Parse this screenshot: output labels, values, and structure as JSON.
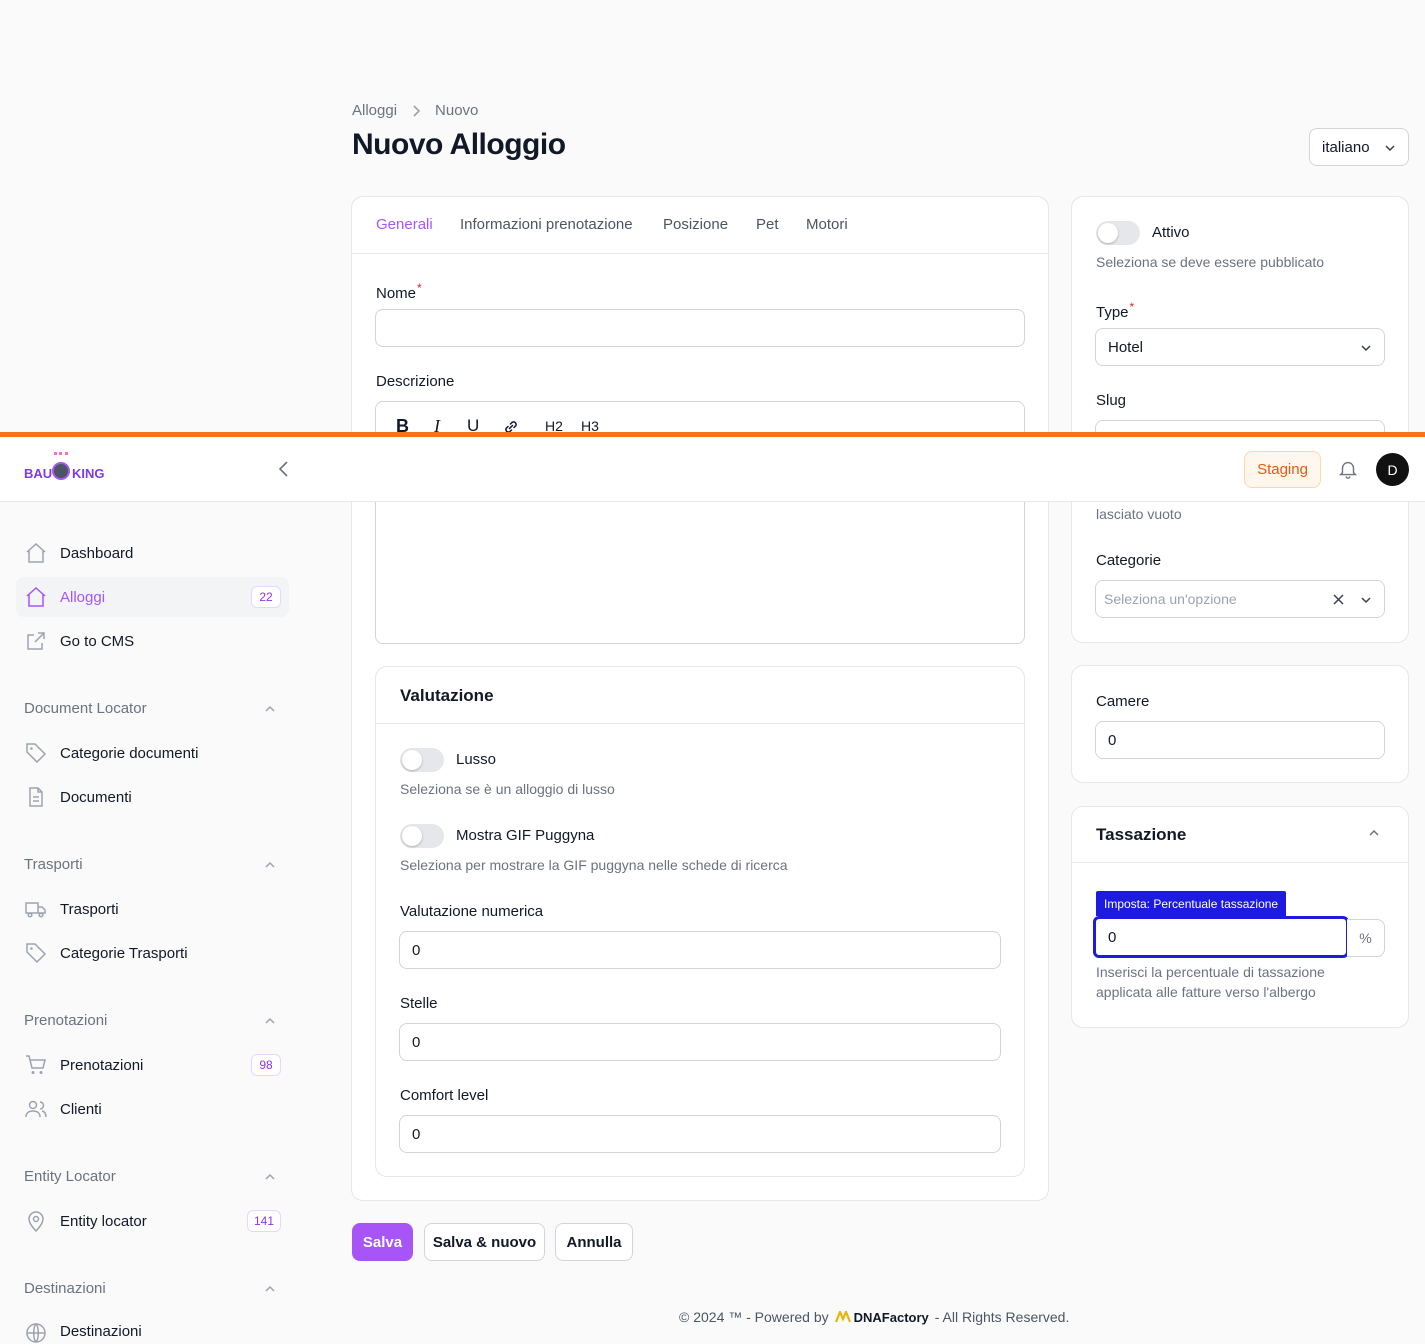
{
  "breadcrumb": {
    "parent": "Alloggi",
    "current": "Nuovo"
  },
  "page_title": "Nuovo Alloggio",
  "language_select": {
    "value": "italiano"
  },
  "tabs": [
    {
      "label": "Generali",
      "active": true
    },
    {
      "label": "Informazioni prenotazione"
    },
    {
      "label": "Posizione"
    },
    {
      "label": "Pet"
    },
    {
      "label": "Motori"
    }
  ],
  "form": {
    "nome_label": "Nome",
    "descrizione_label": "Descrizione",
    "editor_tools": {
      "bold": "B",
      "italic": "I",
      "underline": "U",
      "h2": "H2",
      "h3": "H3"
    }
  },
  "valutazione": {
    "title": "Valutazione",
    "lusso_label": "Lusso",
    "lusso_help": "Seleziona se è un alloggio di lusso",
    "gif_label": "Mostra GIF Puggyna",
    "gif_help": "Seleziona per mostrare la GIF puggyna nelle schede di ricerca",
    "numerica_label": "Valutazione numerica",
    "numerica_value": "0",
    "stelle_label": "Stelle",
    "stelle_value": "0",
    "comfort_label": "Comfort level",
    "comfort_value": "0"
  },
  "side": {
    "attivo_label": "Attivo",
    "attivo_help": "Seleziona se deve essere pubblicato",
    "type_label": "Type",
    "type_value": "Hotel",
    "slug_label": "Slug",
    "slug_help_tail": "lasciato vuoto",
    "categorie_label": "Categorie",
    "categorie_placeholder": "Seleziona un'opzione",
    "camere_label": "Camere",
    "camere_value": "0"
  },
  "tassazione": {
    "title": "Tassazione",
    "tooltip": "Imposta: Percentuale tassazione",
    "value": "0",
    "suffix": "%",
    "help_line1": "Inserisci la percentuale di tassazione",
    "help_line2": "applicata alle fatture verso l'albergo"
  },
  "actions": {
    "save": "Salva",
    "save_new": "Salva & nuovo",
    "cancel": "Annulla"
  },
  "footer": {
    "left": "© 2024 ™ - Powered by",
    "brand": "DNAFactory",
    "right": "- All Rights Reserved."
  },
  "topbar": {
    "logo_left": "BAU",
    "logo_right": "KING",
    "env_badge": "Staging",
    "avatar": "D"
  },
  "sidebar": {
    "items": [
      {
        "label": "Dashboard"
      },
      {
        "label": "Alloggi",
        "badge": "22"
      },
      {
        "label": "Go to CMS"
      }
    ],
    "groups": [
      {
        "title": "Document Locator",
        "items": [
          {
            "label": "Categorie documenti"
          },
          {
            "label": "Documenti"
          }
        ]
      },
      {
        "title": "Trasporti",
        "items": [
          {
            "label": "Trasporti"
          },
          {
            "label": "Categorie Trasporti"
          }
        ]
      },
      {
        "title": "Prenotazioni",
        "items": [
          {
            "label": "Prenotazioni",
            "badge": "98"
          },
          {
            "label": "Clienti"
          }
        ]
      },
      {
        "title": "Entity Locator",
        "items": [
          {
            "label": "Entity locator",
            "badge": "141"
          }
        ]
      },
      {
        "title": "Destinazioni",
        "items": [
          {
            "label": "Destinazioni"
          }
        ]
      }
    ]
  },
  "colors": {
    "primary": "#a855f7",
    "accent_orange": "#f97316",
    "focus_blue": "#1d1be0"
  }
}
